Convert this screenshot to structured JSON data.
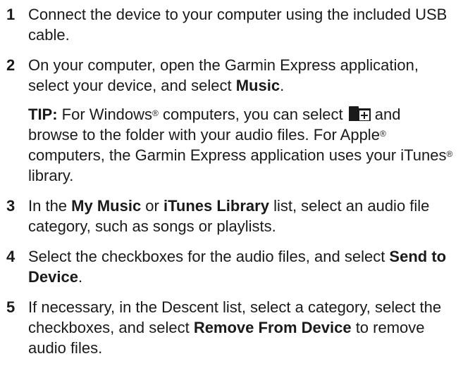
{
  "steps": [
    {
      "num": "1",
      "text": "Connect the device to your computer using the included USB cable."
    },
    {
      "num": "2",
      "text_a": "On your computer, open the Garmin Express application, select your device, and select ",
      "bold_a": "Music",
      "text_b": ".",
      "tip": {
        "label": "TIP:",
        "t1": " For Windows",
        "reg1": "®",
        "t2": " computers, you can select ",
        "icon": "folder-add-icon",
        "t3": " and browse to the folder with your audio files. For Apple",
        "reg2": "®",
        "t4": " computers, the Garmin Express application uses your iTunes",
        "reg3": "®",
        "t5": " library."
      }
    },
    {
      "num": "3",
      "t1": "In the ",
      "b1": "My Music",
      "t2": " or ",
      "b2": "iTunes Library",
      "t3": " list, select an audio file category, such as songs or playlists."
    },
    {
      "num": "4",
      "t1": "Select the checkboxes for the audio files, and select ",
      "b1": "Send to Device",
      "t2": "."
    },
    {
      "num": "5",
      "t1": "If necessary, in the Descent list, select a category, select the checkboxes, and select ",
      "b1": "Remove From Device",
      "t2": " to remove audio files."
    }
  ]
}
